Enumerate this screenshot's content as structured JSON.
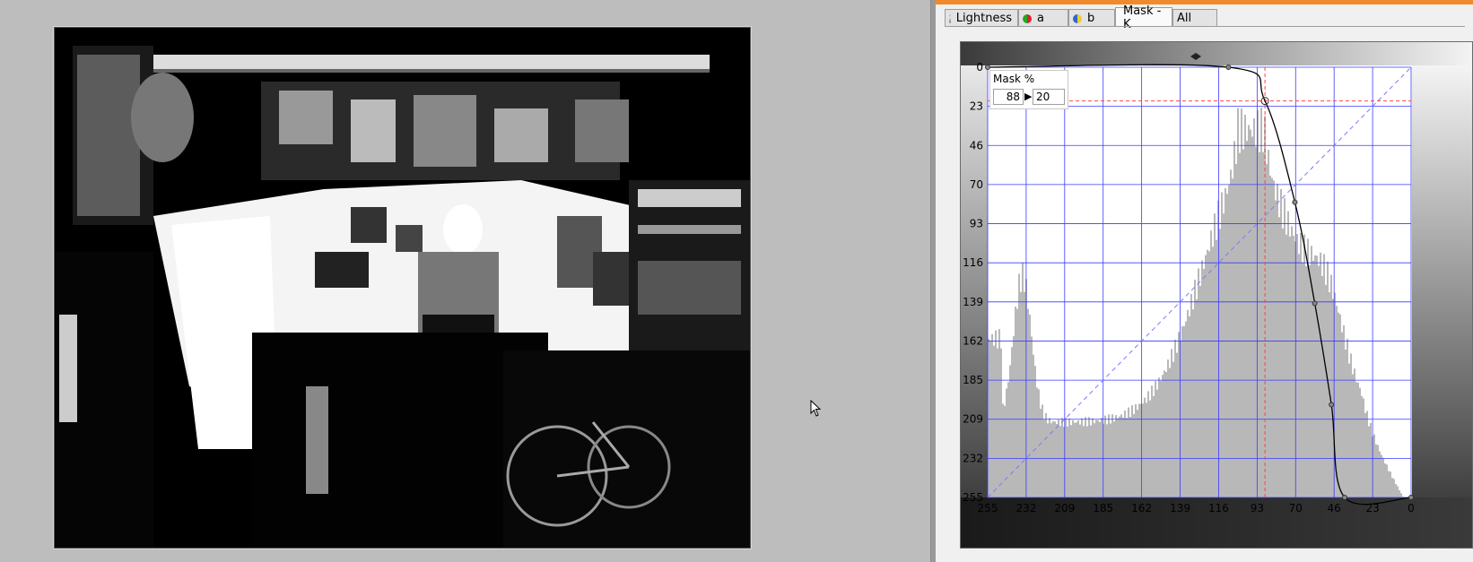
{
  "tabs": [
    {
      "label": "Lightness",
      "icon": "lightness-icon",
      "active": false
    },
    {
      "label": "a",
      "icon": "a-channel-icon",
      "active": false
    },
    {
      "label": "b",
      "icon": "b-channel-icon",
      "active": false
    },
    {
      "label": "Mask - K",
      "icon": "",
      "active": true
    },
    {
      "label": "All",
      "icon": "",
      "active": false
    }
  ],
  "mask_readout": {
    "label": "Mask %",
    "input_value": "88",
    "output_value": "20"
  },
  "y_axis_labels": [
    "0",
    "23",
    "46",
    "70",
    "93",
    "116",
    "139",
    "162",
    "185",
    "209",
    "232",
    "255"
  ],
  "x_axis_labels": [
    "255",
    "232",
    "209",
    "185",
    "162",
    "139",
    "116",
    "93",
    "70",
    "46",
    "23",
    "0"
  ],
  "curve": {
    "input_range": [
      255,
      0
    ],
    "output_range": [
      0,
      255
    ],
    "points": [
      [
        255,
        0
      ],
      [
        110,
        0
      ],
      [
        88,
        20
      ],
      [
        70,
        80
      ],
      [
        58,
        140
      ],
      [
        48,
        200
      ],
      [
        40,
        255
      ],
      [
        0,
        255
      ]
    ],
    "active_point": [
      88,
      20
    ]
  },
  "colors": {
    "accent_strip": "#f08a2c",
    "grid": "#3a3aff",
    "histogram": "#b8b8b8",
    "guide": "#ff4444"
  }
}
